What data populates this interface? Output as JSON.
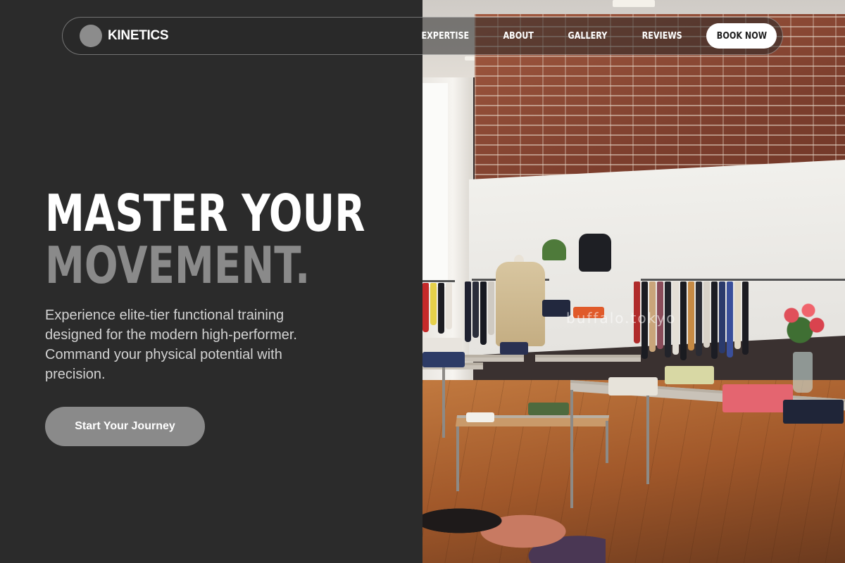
{
  "brand": {
    "name": "KINETICS",
    "logo_color": "#8c8c8c"
  },
  "nav": {
    "links": [
      "EXPERTISE",
      "ABOUT",
      "GALLERY",
      "REVIEWS"
    ],
    "cta_label": "BOOK NOW"
  },
  "hero": {
    "title_line_1": "MASTER YOUR",
    "title_line_2": "MOVEMENT.",
    "subtitle": "Experience elite-tier functional training designed for the modern high-performer. Command your physical potential with precision.",
    "cta_label": "Start Your Journey"
  },
  "photo": {
    "watermark": "buffalo.tokyo"
  },
  "colors": {
    "background": "#2b2b2b",
    "accent_gray": "#8a8a8a",
    "text_white": "#ffffff"
  }
}
